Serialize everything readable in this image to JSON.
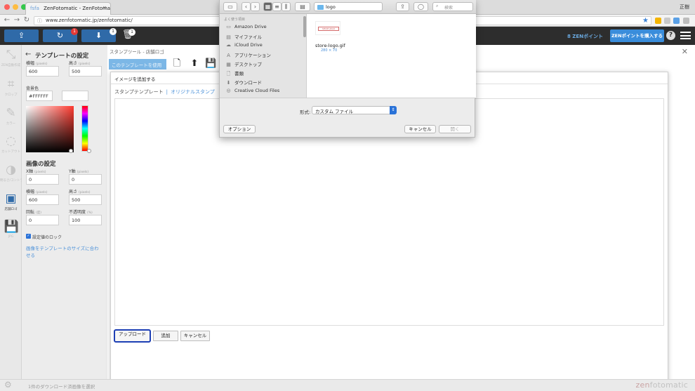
{
  "browser": {
    "tab_title": "ZenFotomatic - ZenFotoma",
    "tab_favicon": "fsfa",
    "url": "www.zenfotomatic.jp/zenfotomatic/",
    "user_label": "正樹"
  },
  "header": {
    "upload_badge": "1",
    "download_badge": "1",
    "trash_badge": "1",
    "points_label": "8 ZENポイント",
    "buy_label": "ZENポイントを購入する",
    "help_glyph": "?"
  },
  "tools": [
    {
      "id": "template",
      "label": "ZEN自動作成",
      "icon": "resize-icon"
    },
    {
      "id": "crop",
      "label": "クロップ",
      "icon": "crop-icon"
    },
    {
      "id": "color",
      "label": "カラー",
      "icon": "paint-icon"
    },
    {
      "id": "cutout",
      "label": "カットアウト",
      "icon": "lasso-icon"
    },
    {
      "id": "contrast",
      "label": "明るさ/コントラスト",
      "icon": "contrast-icon"
    },
    {
      "id": "logo",
      "label": "店舗ロゴ",
      "icon": "logo-icon"
    },
    {
      "id": "save",
      "label": "JPG",
      "icon": "save-icon"
    }
  ],
  "panel": {
    "template_title": "テンプレートの設定",
    "width_label": "横幅",
    "height_label": "高さ",
    "unit_px": "(pixels)",
    "template_width": "600",
    "template_height": "500",
    "bg_label": "背景色",
    "bg_value": "#FFFFFF",
    "image_title": "画像の設定",
    "x_label": "X軸",
    "y_label": "Y軸",
    "x_value": "0",
    "y_value": "0",
    "img_width": "600",
    "img_height": "500",
    "rotate_label": "回転",
    "rotate_unit": "(度)",
    "rotate_value": "0",
    "opacity_label": "不透明度",
    "opacity_unit": "(%)",
    "opacity_value": "100",
    "lock_label": "設定値のロック",
    "fit_link": "画像をテンプレートのサイズに合わせる"
  },
  "main": {
    "breadcrumb": "スタンプツール - 店舗ロゴ",
    "template_button": "このテンプレートを使用",
    "close_glyph": "✕"
  },
  "dialog": {
    "title": "イメージを追加する",
    "tab_template": "スタンプテンプレート",
    "tab_separator": "|",
    "tab_original": "オリジナルスタンプ",
    "btn_upload": "アップロード",
    "btn_add": "追加",
    "btn_cancel": "キャンセル"
  },
  "status": {
    "text": "1件のダウンロード済画像を選択",
    "brand_prefix": "zen",
    "brand_suffix": "fotomatic"
  },
  "file_picker": {
    "folder": "logo",
    "search_placeholder": "検索",
    "favorites_header": "よく使う項目",
    "sidebar": [
      {
        "label": "Amazon Drive",
        "icon": "folder-icon"
      },
      {
        "label": "マイファイル",
        "icon": "files-icon"
      },
      {
        "label": "iCloud Drive",
        "icon": "cloud-icon"
      },
      {
        "label": "アプリケーション",
        "icon": "apps-icon"
      },
      {
        "label": "デスクトップ",
        "icon": "desktop-icon"
      },
      {
        "label": "書類",
        "icon": "document-icon"
      },
      {
        "label": "ダウンロード",
        "icon": "download-icon"
      },
      {
        "label": "Creative Cloud Files",
        "icon": "creative-cloud-icon"
      }
    ],
    "file_name": "store-logo.gif",
    "file_dims": "280 × 70",
    "thumb_text": "SHOP LOGO",
    "format_label": "形式:",
    "format_value": "カスタム ファイル",
    "btn_options": "オプション",
    "btn_cancel": "キャンセル",
    "btn_open": "開く"
  },
  "colors": {
    "accent": "#2f6aa8",
    "buy_button": "#3a8ddb",
    "upload_highlight": "#1d3fb4"
  }
}
